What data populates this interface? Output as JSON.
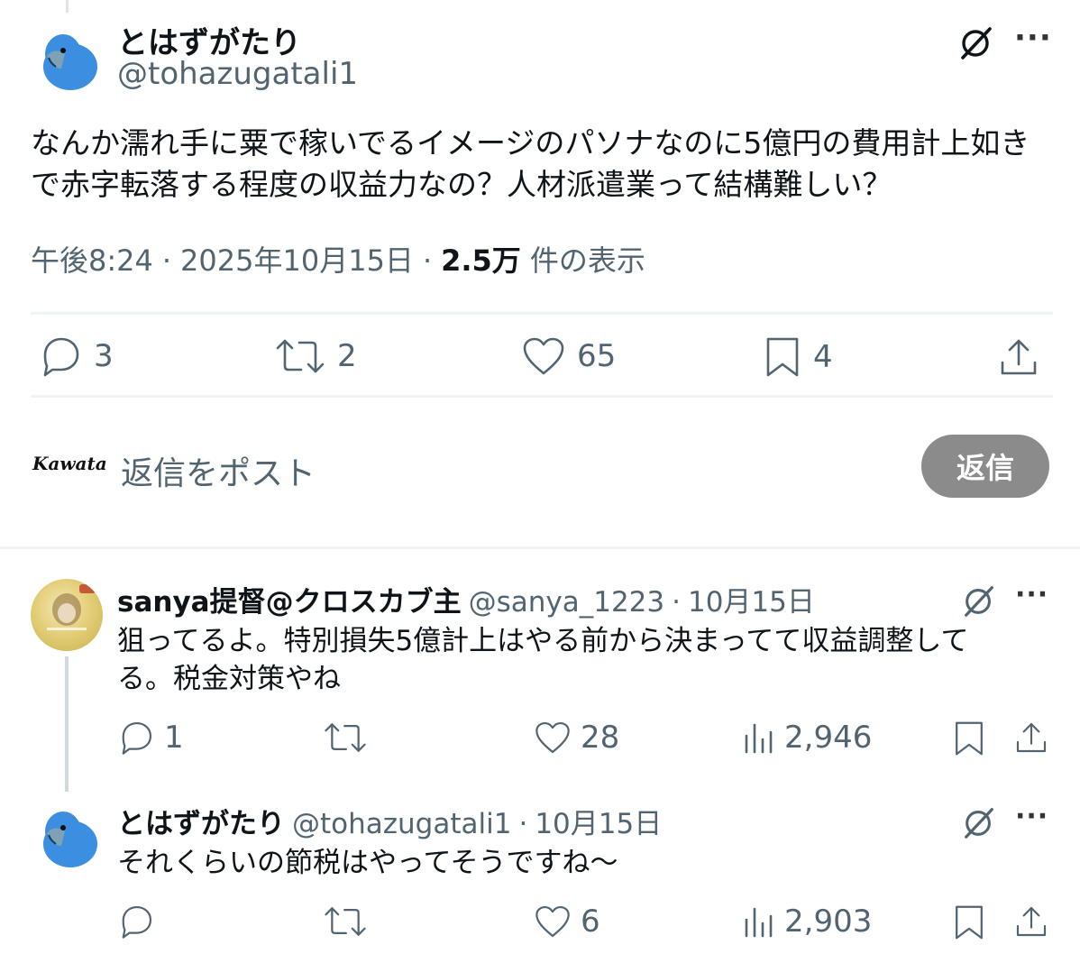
{
  "tweet": {
    "author_name": "とはずがたり",
    "author_handle": "@tohazugatali1",
    "text_line1": "なんか濡れ手に粟で稼いでるイメージのパソナなのに5億円の費用計上如き",
    "text_line2": "で赤字転落する程度の収益力なの？人材派遣業って結構難しい？",
    "time": "午後8:24",
    "date": "2025年10月15日",
    "views_count": "2.5万",
    "views_label": "件の表示",
    "separator": "·",
    "stats": {
      "replies": "3",
      "retweets": "2",
      "likes": "65",
      "bookmarks": "4"
    }
  },
  "compose": {
    "avatar_text": "Kawata",
    "placeholder": "返信をポスト",
    "button_label": "返信"
  },
  "replies": [
    {
      "author_name": "sanya提督@クロスカブ主",
      "author_handle": "@sanya_1223",
      "date": "10月15日",
      "text_line1": "狙ってるよ。特別損失5億計上はやる前から決まってて収益調整して",
      "text_line2": "る。税金対策やね",
      "replies": "1",
      "retweets": "",
      "likes": "28",
      "views": "2,946"
    },
    {
      "author_name": "とはずがたり",
      "author_handle": "@tohazugatali1",
      "date": "10月15日",
      "text_line1": "それくらいの節税はやってそうですね〜",
      "replies": "",
      "retweets": "",
      "likes": "6",
      "views": "2,903"
    }
  ],
  "colors": {
    "text": "#0f1419",
    "muted": "#536471",
    "parrot_blue": "#3b8ee0",
    "button_gray": "#8b8b8b"
  },
  "icons": [
    "parrot-avatar-icon",
    "grok-icon",
    "more-icon",
    "reply-icon",
    "retweet-icon",
    "like-icon",
    "bookmark-icon",
    "share-icon",
    "views-icon"
  ]
}
